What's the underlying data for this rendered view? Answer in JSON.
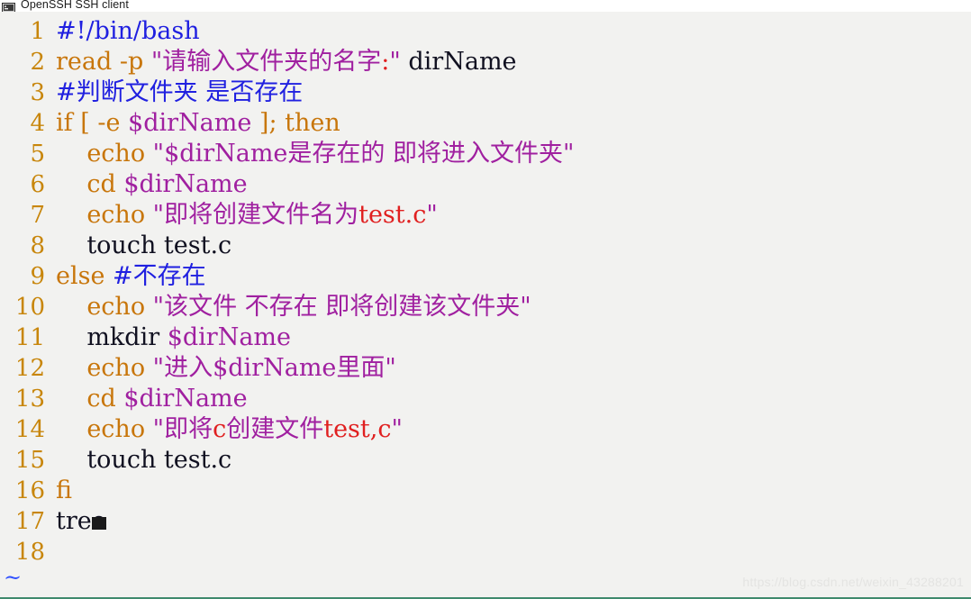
{
  "window": {
    "title": "OpenSSH SSH client",
    "icon": "terminal-icon",
    "background_color": "#f2f2f0",
    "bottom_border_color": "#3f8a6d"
  },
  "colors": {
    "lineno": "#c8860b",
    "keyword": "#c8760b",
    "comment": "#2020e0",
    "string": "#a020a0",
    "variable": "#a020a0",
    "plain": "#101020",
    "red_ascii": "#e02020",
    "tilde": "#3050ff"
  },
  "editor": {
    "empty_buffer_marker": "~",
    "cursor_line": 17,
    "lines": [
      {
        "n": "1",
        "tokens": [
          {
            "t": "#!/bin/bash",
            "c": "cmt"
          }
        ]
      },
      {
        "n": "2",
        "tokens": [
          {
            "t": "read -p ",
            "c": "kw"
          },
          {
            "t": "\"",
            "c": "quote"
          },
          {
            "t": "请输入文件夹的名字",
            "c": "str"
          },
          {
            "t": ":",
            "c": "red"
          },
          {
            "t": "\"",
            "c": "quote"
          },
          {
            "t": " ",
            "c": "plain"
          },
          {
            "t": "dirName",
            "c": "plain"
          }
        ]
      },
      {
        "n": "3",
        "tokens": [
          {
            "t": "#判断文件夹 是否存在",
            "c": "cmt"
          }
        ]
      },
      {
        "n": "4",
        "tokens": [
          {
            "t": "if [ -e ",
            "c": "kw"
          },
          {
            "t": "$dirName",
            "c": "var"
          },
          {
            "t": " ]; then",
            "c": "kw"
          }
        ]
      },
      {
        "n": "5",
        "tokens": [
          {
            "t": "    echo ",
            "c": "kw"
          },
          {
            "t": "\"",
            "c": "quote"
          },
          {
            "t": "$dirName是存在的 即将进入文件夹",
            "c": "str"
          },
          {
            "t": "\"",
            "c": "quote"
          }
        ]
      },
      {
        "n": "6",
        "tokens": [
          {
            "t": "    cd ",
            "c": "kw"
          },
          {
            "t": "$dirName",
            "c": "var"
          }
        ]
      },
      {
        "n": "7",
        "tokens": [
          {
            "t": "    echo ",
            "c": "kw"
          },
          {
            "t": "\"",
            "c": "quote"
          },
          {
            "t": "即将创建文件名为",
            "c": "str"
          },
          {
            "t": "test.c",
            "c": "red"
          },
          {
            "t": "\"",
            "c": "quote"
          }
        ]
      },
      {
        "n": "8",
        "tokens": [
          {
            "t": "    touch test.c",
            "c": "plain"
          }
        ]
      },
      {
        "n": "9",
        "tokens": [
          {
            "t": "else ",
            "c": "kw"
          },
          {
            "t": "#不存在",
            "c": "cmt"
          }
        ]
      },
      {
        "n": "10",
        "tokens": [
          {
            "t": "    echo ",
            "c": "kw"
          },
          {
            "t": "\"",
            "c": "quote"
          },
          {
            "t": "该文件 不存在 即将创建该文件夹",
            "c": "str"
          },
          {
            "t": "\"",
            "c": "quote"
          }
        ]
      },
      {
        "n": "11",
        "tokens": [
          {
            "t": "    mkdir ",
            "c": "plain"
          },
          {
            "t": "$dirName",
            "c": "var"
          }
        ]
      },
      {
        "n": "12",
        "tokens": [
          {
            "t": "    echo ",
            "c": "kw"
          },
          {
            "t": "\"",
            "c": "quote"
          },
          {
            "t": "进入$dirName里面",
            "c": "str"
          },
          {
            "t": "\"",
            "c": "quote"
          }
        ]
      },
      {
        "n": "13",
        "tokens": [
          {
            "t": "    cd ",
            "c": "kw"
          },
          {
            "t": "$dirName",
            "c": "var"
          }
        ]
      },
      {
        "n": "14",
        "tokens": [
          {
            "t": "    echo ",
            "c": "kw"
          },
          {
            "t": "\"",
            "c": "quote"
          },
          {
            "t": "即将",
            "c": "str"
          },
          {
            "t": "c",
            "c": "red"
          },
          {
            "t": "创建文件",
            "c": "str"
          },
          {
            "t": "test,c",
            "c": "red"
          },
          {
            "t": "\"",
            "c": "quote"
          }
        ]
      },
      {
        "n": "15",
        "tokens": [
          {
            "t": "    touch test.c",
            "c": "plain"
          }
        ]
      },
      {
        "n": "16",
        "tokens": [
          {
            "t": "fi",
            "c": "kw"
          }
        ]
      },
      {
        "n": "17",
        "tokens": [
          {
            "t": "tree",
            "c": "plain"
          }
        ],
        "cursor": true
      },
      {
        "n": "18",
        "tokens": []
      }
    ]
  },
  "watermark": {
    "text": "https://blog.csdn.net/weixin_43288201"
  }
}
